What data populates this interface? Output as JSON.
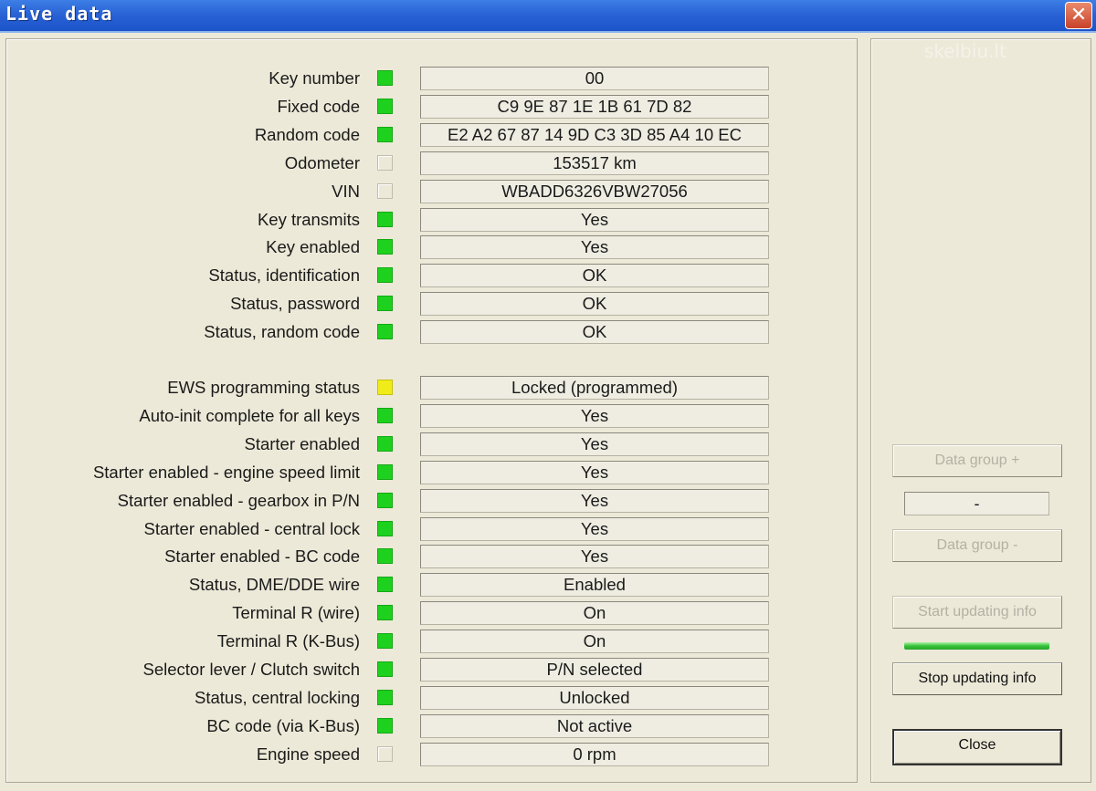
{
  "window": {
    "title": "Live data",
    "close_glyph": "✕"
  },
  "watermark": "skelbiu.lt",
  "colors": {
    "led_green": "#1ed11e",
    "led_yellow": "#f0ec1a",
    "titlebar": "#2a63d6"
  },
  "rows": [
    {
      "label": "Key number",
      "status": "green",
      "value": "00"
    },
    {
      "label": "Fixed code",
      "status": "green",
      "value": "C9 9E 87 1E 1B 61 7D 82"
    },
    {
      "label": "Random code",
      "status": "green",
      "value": "E2 A2 67 87 14 9D C3 3D 85 A4 10 EC"
    },
    {
      "label": "Odometer",
      "status": "off",
      "value": "153517 km"
    },
    {
      "label": "VIN",
      "status": "off",
      "value": "WBADD6326VBW27056"
    },
    {
      "label": "Key transmits",
      "status": "green",
      "value": "Yes"
    },
    {
      "label": "Key enabled",
      "status": "green",
      "value": "Yes"
    },
    {
      "label": "Status, identification",
      "status": "green",
      "value": "OK"
    },
    {
      "label": "Status, password",
      "status": "green",
      "value": "OK"
    },
    {
      "label": "Status, random code",
      "status": "green",
      "value": "OK"
    },
    {
      "label": "EWS programming status",
      "status": "yellow",
      "value": "Locked (programmed)"
    },
    {
      "label": "Auto-init complete for all keys",
      "status": "green",
      "value": "Yes"
    },
    {
      "label": "Starter enabled",
      "status": "green",
      "value": "Yes"
    },
    {
      "label": "Starter enabled - engine speed limit",
      "status": "green",
      "value": "Yes"
    },
    {
      "label": "Starter enabled - gearbox in P/N",
      "status": "green",
      "value": "Yes"
    },
    {
      "label": "Starter enabled - central lock",
      "status": "green",
      "value": "Yes"
    },
    {
      "label": "Starter enabled - BC code",
      "status": "green",
      "value": "Yes"
    },
    {
      "label": "Status, DME/DDE wire",
      "status": "green",
      "value": "Enabled"
    },
    {
      "label": "Terminal R (wire)",
      "status": "green",
      "value": "On"
    },
    {
      "label": "Terminal R (K-Bus)",
      "status": "green",
      "value": "On"
    },
    {
      "label": "Selector lever / Clutch switch",
      "status": "green",
      "value": "P/N selected"
    },
    {
      "label": "Status, central locking",
      "status": "green",
      "value": "Unlocked"
    },
    {
      "label": "BC code (via K-Bus)",
      "status": "green",
      "value": "Not active"
    },
    {
      "label": "Engine speed",
      "status": "off",
      "value": "0 rpm"
    }
  ],
  "side": {
    "data_group_plus": "Data group +",
    "data_group_value": "-",
    "data_group_minus": "Data group -",
    "start_updating": "Start updating info",
    "update_progress": 1.0,
    "stop_updating": "Stop updating info",
    "close": "Close"
  }
}
